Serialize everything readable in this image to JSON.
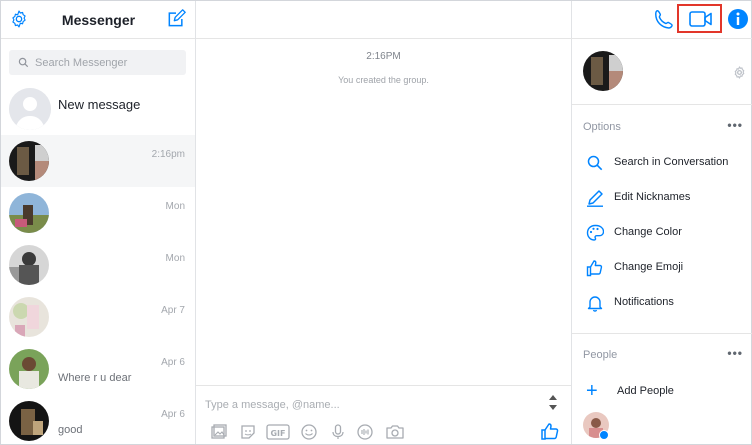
{
  "app": {
    "title": "Messenger"
  },
  "search": {
    "placeholder": "Search Messenger"
  },
  "new_message": {
    "label": "New message"
  },
  "conversations": [
    {
      "name": "",
      "time": "2:16pm",
      "snippet": ""
    },
    {
      "name": "",
      "time": "Mon",
      "snippet": ""
    },
    {
      "name": "",
      "time": "Mon",
      "snippet": ""
    },
    {
      "name": "",
      "time": "Apr 7",
      "snippet": ""
    },
    {
      "name": "",
      "time": "Apr 6",
      "snippet": "Where r u dear"
    },
    {
      "name": "",
      "time": "Apr 6",
      "snippet": "good"
    }
  ],
  "chat": {
    "title": "",
    "timestamp": "2:16PM",
    "system_message": "You created the group."
  },
  "composer": {
    "placeholder": "Type a message, @name..."
  },
  "right_panel": {
    "group_name": "",
    "options_label": "Options",
    "options": [
      {
        "label": "Search in Conversation",
        "icon": "search-icon"
      },
      {
        "label": "Edit Nicknames",
        "icon": "pencil-icon"
      },
      {
        "label": "Change Color",
        "icon": "palette-icon"
      },
      {
        "label": "Change Emoji",
        "icon": "thumbs-up-icon"
      },
      {
        "label": "Notifications",
        "icon": "bell-icon"
      }
    ],
    "people_label": "People",
    "add_people_label": "Add People",
    "more_label": "•••"
  },
  "colors": {
    "accent": "#0084ff",
    "highlight": "#e2362a"
  }
}
